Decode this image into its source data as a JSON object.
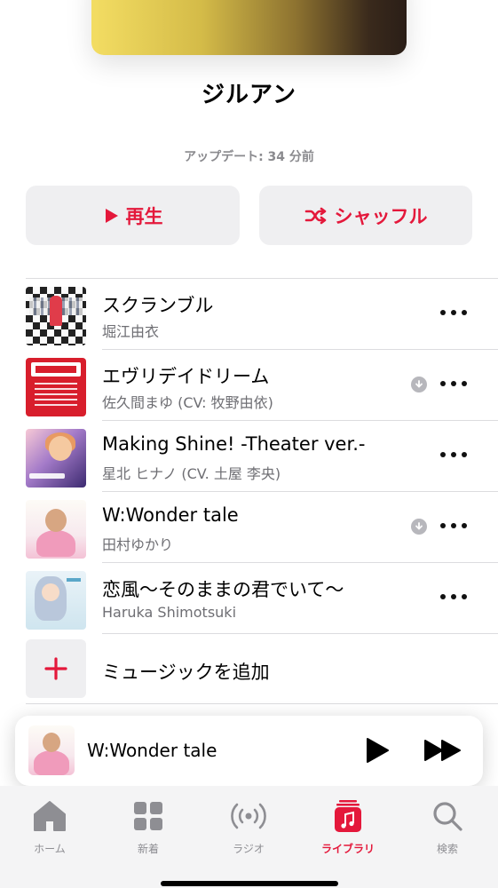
{
  "playlist": {
    "title": "ジルアン",
    "update_text": "アップデート: 34 分前"
  },
  "actions": {
    "play_label": "再生",
    "shuffle_label": "シャッフル"
  },
  "tracks": [
    {
      "title": "スクランブル",
      "artist": "堀江由衣",
      "downloadable": false
    },
    {
      "title": "エヴリデイドリーム",
      "artist": "佐久間まゆ (CV: 牧野由依)",
      "downloadable": true
    },
    {
      "title": "Making Shine! -Theater ver.-",
      "artist": "星北 ヒナノ (CV. 土屋 李央)",
      "downloadable": false
    },
    {
      "title": "W:Wonder tale",
      "artist": "田村ゆかり",
      "downloadable": true
    },
    {
      "title": "恋風〜そのままの君でいて〜",
      "artist": "Haruka Shimotsuki",
      "downloadable": false
    }
  ],
  "add_music_label": "ミュージックを追加",
  "now_playing": {
    "title": "W:Wonder tale"
  },
  "tabbar": {
    "items": [
      {
        "label": "ホーム",
        "icon": "home-icon",
        "active": false
      },
      {
        "label": "新着",
        "icon": "grid-icon",
        "active": false
      },
      {
        "label": "ラジオ",
        "icon": "radio-icon",
        "active": false
      },
      {
        "label": "ライブラリ",
        "icon": "library-icon",
        "active": true
      },
      {
        "label": "検索",
        "icon": "search-icon",
        "active": false
      }
    ]
  },
  "colors": {
    "accent": "#e4183b",
    "secondary_text": "#6e6e73",
    "button_bg": "#efeff1"
  }
}
